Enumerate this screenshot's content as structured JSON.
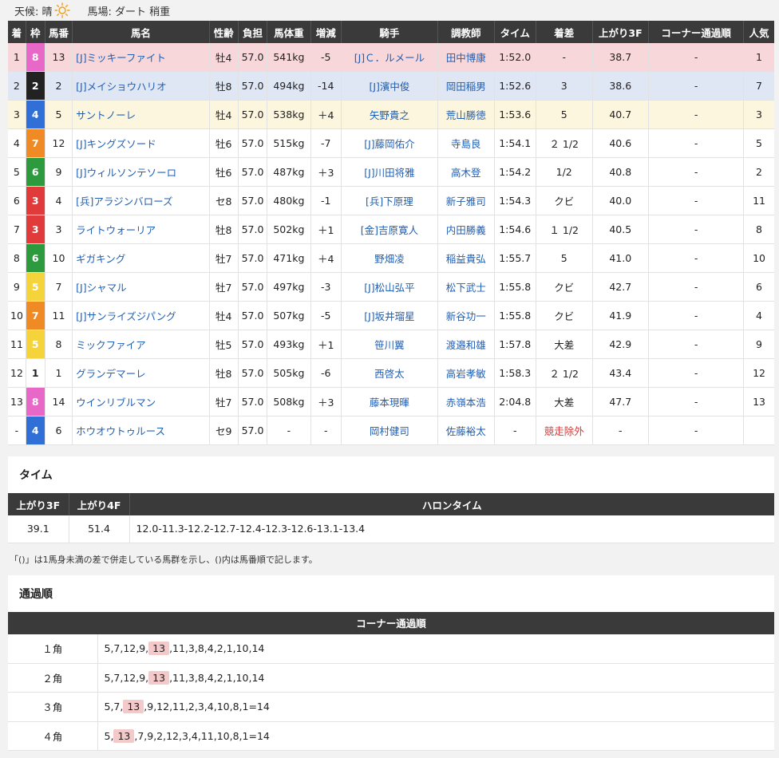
{
  "weather": {
    "label": "天候: 晴",
    "icon": "sun-icon",
    "track": "馬場: ダート 稍重"
  },
  "results": {
    "headers": [
      "着",
      "枠",
      "馬番",
      "馬名",
      "性齢",
      "負担",
      "馬体重",
      "増減",
      "騎手",
      "調教師",
      "タイム",
      "着差",
      "上がり3F",
      "コーナー通過順",
      "人気"
    ],
    "rows": [
      {
        "pos": "1",
        "waku": "8",
        "num": "13",
        "horse": "[J]ミッキーファイト",
        "sex": "牡4",
        "weight": "57.0",
        "body": "541kg",
        "diff": "-5",
        "jockey": "[J]Ｃ．ルメール",
        "trainer": "田中博康",
        "time": "1:52.0",
        "margin": "-",
        "f3": "38.7",
        "corner": "-",
        "pop": "1"
      },
      {
        "pos": "2",
        "waku": "2",
        "num": "2",
        "horse": "[J]メイショウハリオ",
        "sex": "牡8",
        "weight": "57.0",
        "body": "494kg",
        "diff": "-14",
        "jockey": "[J]濱中俊",
        "trainer": "岡田稲男",
        "time": "1:52.6",
        "margin": "3",
        "f3": "38.6",
        "corner": "-",
        "pop": "7"
      },
      {
        "pos": "3",
        "waku": "4",
        "num": "5",
        "horse": "サントノーレ",
        "sex": "牡4",
        "weight": "57.0",
        "body": "538kg",
        "diff": "＋4",
        "jockey": "矢野貴之",
        "trainer": "荒山勝徳",
        "time": "1:53.6",
        "margin": "5",
        "f3": "40.7",
        "corner": "-",
        "pop": "3"
      },
      {
        "pos": "4",
        "waku": "7",
        "num": "12",
        "horse": "[J]キングズソード",
        "sex": "牡6",
        "weight": "57.0",
        "body": "515kg",
        "diff": "-7",
        "jockey": "[J]藤岡佑介",
        "trainer": "寺島良",
        "time": "1:54.1",
        "margin": "２ 1/2",
        "f3": "40.6",
        "corner": "-",
        "pop": "5"
      },
      {
        "pos": "5",
        "waku": "6",
        "num": "9",
        "horse": "[J]ウィルソンテソーロ",
        "sex": "牡6",
        "weight": "57.0",
        "body": "487kg",
        "diff": "＋3",
        "jockey": "[J]川田将雅",
        "trainer": "高木登",
        "time": "1:54.2",
        "margin": "1/2",
        "f3": "40.8",
        "corner": "-",
        "pop": "2"
      },
      {
        "pos": "6",
        "waku": "3",
        "num": "4",
        "horse": "[兵]アラジンバローズ",
        "sex": "セ8",
        "weight": "57.0",
        "body": "480kg",
        "diff": "-1",
        "jockey": "[兵]下原理",
        "trainer": "新子雅司",
        "time": "1:54.3",
        "margin": "クビ",
        "f3": "40.0",
        "corner": "-",
        "pop": "11"
      },
      {
        "pos": "7",
        "waku": "3",
        "num": "3",
        "horse": "ライトウォーリア",
        "sex": "牡8",
        "weight": "57.0",
        "body": "502kg",
        "diff": "＋1",
        "jockey": "[金]吉原寛人",
        "trainer": "内田勝義",
        "time": "1:54.6",
        "margin": "１ 1/2",
        "f3": "40.5",
        "corner": "-",
        "pop": "8"
      },
      {
        "pos": "8",
        "waku": "6",
        "num": "10",
        "horse": "ギガキング",
        "sex": "牡7",
        "weight": "57.0",
        "body": "471kg",
        "diff": "＋4",
        "jockey": "野畑凌",
        "trainer": "稲益貴弘",
        "time": "1:55.7",
        "margin": "5",
        "f3": "41.0",
        "corner": "-",
        "pop": "10"
      },
      {
        "pos": "9",
        "waku": "5",
        "num": "7",
        "horse": "[J]シャマル",
        "sex": "牡7",
        "weight": "57.0",
        "body": "497kg",
        "diff": "-3",
        "jockey": "[J]松山弘平",
        "trainer": "松下武士",
        "time": "1:55.8",
        "margin": "クビ",
        "f3": "42.7",
        "corner": "-",
        "pop": "6"
      },
      {
        "pos": "10",
        "waku": "7",
        "num": "11",
        "horse": "[J]サンライズジパング",
        "sex": "牡4",
        "weight": "57.0",
        "body": "507kg",
        "diff": "-5",
        "jockey": "[J]坂井瑠星",
        "trainer": "新谷功一",
        "time": "1:55.8",
        "margin": "クビ",
        "f3": "41.9",
        "corner": "-",
        "pop": "4"
      },
      {
        "pos": "11",
        "waku": "5",
        "num": "8",
        "horse": "ミックファイア",
        "sex": "牡5",
        "weight": "57.0",
        "body": "493kg",
        "diff": "＋1",
        "jockey": "笹川翼",
        "trainer": "渡邉和雄",
        "time": "1:57.8",
        "margin": "大差",
        "f3": "42.9",
        "corner": "-",
        "pop": "9"
      },
      {
        "pos": "12",
        "waku": "1",
        "num": "1",
        "horse": "グランデマーレ",
        "sex": "牡8",
        "weight": "57.0",
        "body": "505kg",
        "diff": "-6",
        "jockey": "西啓太",
        "trainer": "高岩孝敏",
        "time": "1:58.3",
        "margin": "２ 1/2",
        "f3": "43.4",
        "corner": "-",
        "pop": "12"
      },
      {
        "pos": "13",
        "waku": "8",
        "num": "14",
        "horse": "ウインリブルマン",
        "sex": "牡7",
        "weight": "57.0",
        "body": "508kg",
        "diff": "＋3",
        "jockey": "藤本現暉",
        "trainer": "赤嶺本浩",
        "time": "2:04.8",
        "margin": "大差",
        "f3": "47.7",
        "corner": "-",
        "pop": "13"
      },
      {
        "pos": "-",
        "waku": "4",
        "num": "6",
        "horse": "ホウオウトゥルース",
        "sex": "セ9",
        "weight": "57.0",
        "body": "-",
        "diff": "-",
        "jockey": "岡村健司",
        "trainer": "佐藤裕太",
        "time": "-",
        "margin": "競走除外",
        "f3": "-",
        "corner": "-",
        "pop": ""
      }
    ]
  },
  "waku_colors": {
    "1": {
      "bg": "#ffffff",
      "fg": "#222222"
    },
    "2": {
      "bg": "#222222",
      "fg": "#ffffff"
    },
    "3": {
      "bg": "#e03a3a",
      "fg": "#ffffff"
    },
    "4": {
      "bg": "#2f6fd6",
      "fg": "#ffffff"
    },
    "5": {
      "bg": "#f5d33a",
      "fg": "#ffffff"
    },
    "6": {
      "bg": "#2e9a3e",
      "fg": "#ffffff"
    },
    "7": {
      "bg": "#f08a24",
      "fg": "#ffffff"
    },
    "8": {
      "bg": "#e868c8",
      "fg": "#ffffff"
    }
  },
  "time_section": {
    "title": "タイム",
    "headers": [
      "上がり3F",
      "上がり4F",
      "ハロンタイム"
    ],
    "f3": "39.1",
    "f4": "51.4",
    "haron": "12.0-11.3-12.2-12.7-12.4-12.3-12.6-13.1-13.4"
  },
  "note": "「()」は1馬身未満の差で併走している馬群を示し、()内は馬番順で記します。",
  "corner_section": {
    "title": "通過順",
    "header": "コーナー通過順",
    "rows": [
      {
        "name": "１角",
        "before": "5,7,12,9,",
        "hl": "13",
        "after": ",11,3,8,4,2,1,10,14"
      },
      {
        "name": "２角",
        "before": "5,7,12,9,",
        "hl": "13",
        "after": ",11,3,8,4,2,1,10,14"
      },
      {
        "name": "３角",
        "before": "5,7,",
        "hl": "13",
        "after": ",9,12,11,2,3,4,10,8,1=14"
      },
      {
        "name": "４角",
        "before": "5,",
        "hl": "13",
        "after": ",7,9,2,12,3,4,11,10,8,1=14"
      }
    ]
  }
}
